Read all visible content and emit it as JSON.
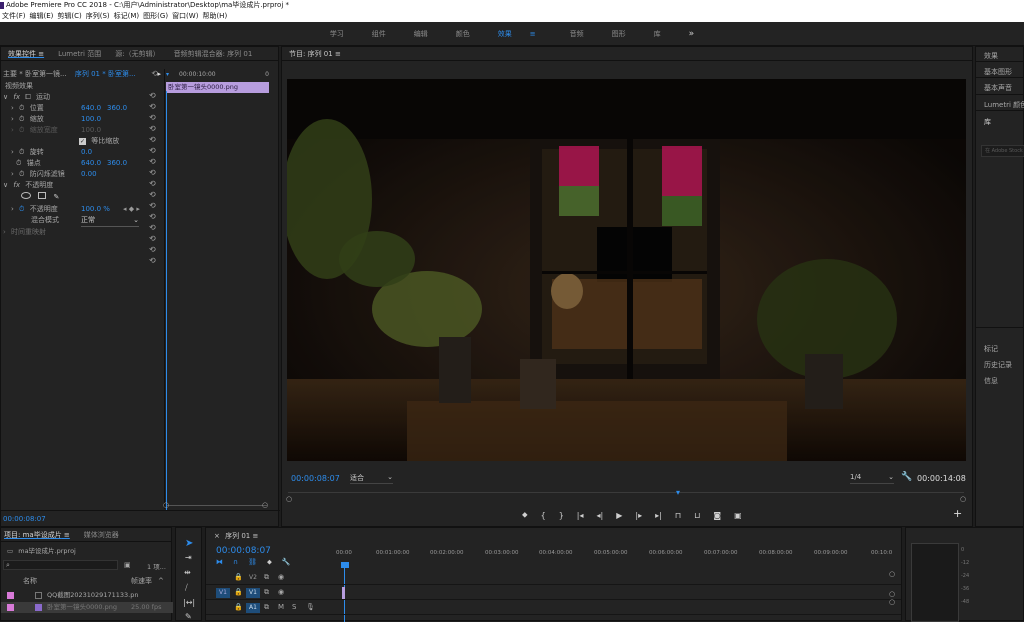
{
  "app": {
    "title": "Adobe Premiere Pro CC 2018 - C:\\用户\\Administrator\\Desktop\\ma毕设成片.prproj *"
  },
  "menu": [
    "文件(F)",
    "编辑(E)",
    "剪辑(C)",
    "序列(S)",
    "标记(M)",
    "图形(G)",
    "窗口(W)",
    "帮助(H)"
  ],
  "workspaces": {
    "items": [
      "学习",
      "组件",
      "编辑",
      "颜色",
      "效果",
      "音频",
      "图形",
      "库"
    ],
    "active": "效果",
    "more": "»"
  },
  "effect_controls": {
    "tabs": [
      "效果控件",
      "Lumetri 范围",
      "源:（无剪辑）",
      "音频剪辑混合器: 序列 01"
    ],
    "header_left": "主要 * 卧室第一镜...",
    "header_seq": "序列 01 * 卧室第...",
    "timecode_start": "00:00:10:00",
    "timecode_end": "0",
    "clip_name": "卧室第一镜头0000.png",
    "video_effects_label": "视频效果",
    "motion": "运动",
    "position_label": "位置",
    "position_x": "640.0",
    "position_y": "360.0",
    "scale_label": "缩放",
    "scale_val": "100.0",
    "scale_width_label": "缩放宽度",
    "scale_width_val": "100.0",
    "uniform_scale": "等比缩放",
    "rotation_label": "旋转",
    "rotation_val": "0.0",
    "anchor_label": "锚点",
    "anchor_x": "640.0",
    "anchor_y": "360.0",
    "flicker_label": "防闪烁滤镜",
    "flicker_val": "0.00",
    "opacity_section": "不透明度",
    "opacity_label": "不透明度",
    "opacity_val": "100.0 %",
    "blend_label": "混合模式",
    "blend_val": "正常",
    "time_remap": "时间重映射",
    "footer_timecode": "00:00:08:07"
  },
  "program": {
    "title": "节目: 序列 01",
    "timecode": "00:00:08:07",
    "fit": "适合",
    "resolution": "1/4",
    "duration": "00:00:14:08"
  },
  "right_panel": {
    "items": [
      "效果",
      "基本图形",
      "基本声音",
      "Lumetri 颜色",
      "库"
    ],
    "adobe_stock": "在 Adobe Stock",
    "lower": [
      "标记",
      "历史记录",
      "信息"
    ]
  },
  "project": {
    "tabs": [
      "项目: ma毕设成片",
      "媒体浏览器"
    ],
    "file": "ma毕设成片.prproj",
    "count": "1 项...",
    "col_name": "名称",
    "col_rate": "帧速率",
    "items": [
      {
        "name": "QQ截图20231029171133.pn",
        "rate": ""
      },
      {
        "name": "卧室第一镜头0000.png",
        "rate": "25.00 fps"
      }
    ]
  },
  "timeline": {
    "tab": "序列 01",
    "timecode": "00:00:08:07",
    "ruler": [
      "00:00",
      "00:01:00:00",
      "00:02:00:00",
      "00:03:00:00",
      "00:04:00:00",
      "00:05:00:00",
      "00:06:00:00",
      "00:07:00:00",
      "00:08:00:00",
      "00:09:00:00",
      "00:10:0"
    ],
    "tracks": [
      {
        "src": "",
        "name": "V2"
      },
      {
        "src": "V1",
        "name": "V1"
      },
      {
        "src": "",
        "name": "A1"
      }
    ]
  },
  "audio_meter": {
    "labels": [
      "0",
      "-12",
      "-24",
      "-36",
      "-48"
    ]
  },
  "colors": {
    "accent": "#2d8ceb",
    "clip": "#b79dde",
    "panel": "#232323"
  }
}
